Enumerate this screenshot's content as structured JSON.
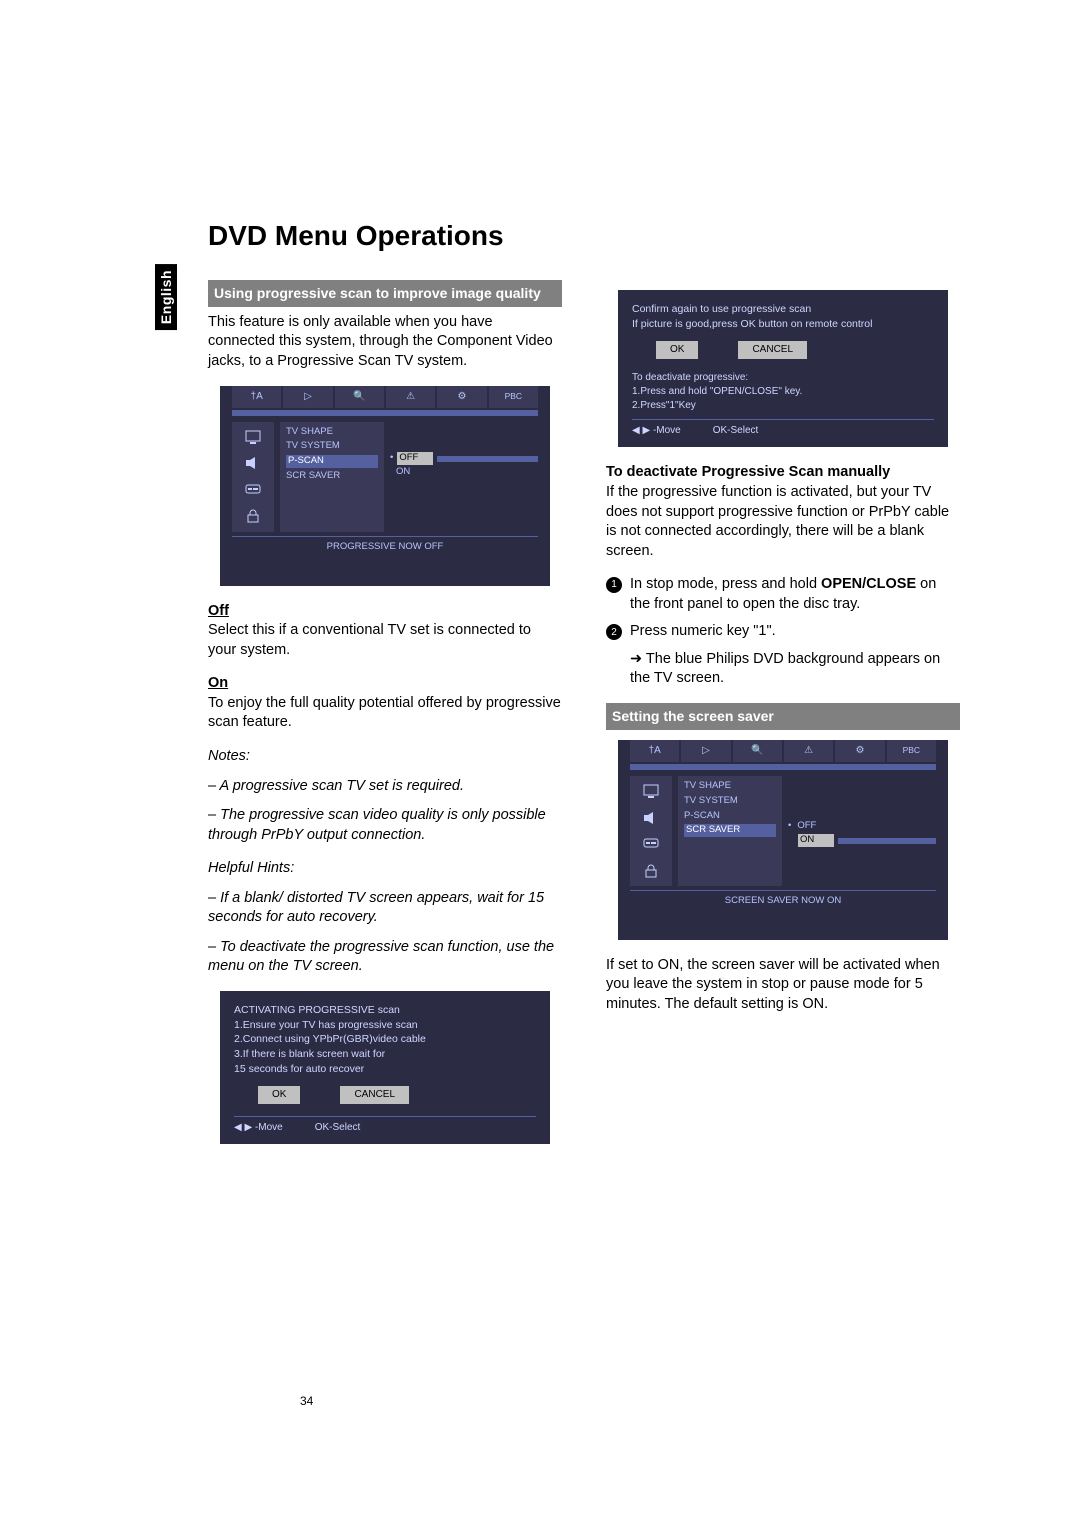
{
  "language_tab": "English",
  "title": "DVD Menu Operations",
  "page_number": "34",
  "section_progscan": {
    "band": "Using progressive scan to improve image quality",
    "intro": "This feature is only available when you have connected this system,  through the Component Video jacks, to a Progressive Scan TV system."
  },
  "osd_pscan": {
    "tabs": [
      "†A",
      "▷",
      "🔍",
      "⚠",
      "⚙",
      "PBC"
    ],
    "items": [
      "TV SHAPE",
      "TV SYSTEM",
      "P-SCAN",
      "SCR SAVER"
    ],
    "opts": [
      "OFF",
      "ON"
    ],
    "status": "PROGRESSIVE NOW OFF"
  },
  "off_head": "Off",
  "off_body": "Select this if a conventional TV set is connected to your system.",
  "on_head": "On",
  "on_body": "To enjoy the full quality potential offered by progressive scan feature.",
  "notes_head": "Notes:",
  "notes_1": "–  A progressive scan TV set is required.",
  "notes_2": "–  The progressive scan video quality is only possible through PrPbY output connection.",
  "hints_head": "Helpful Hints:",
  "hints_1": "–  If a blank/ distorted TV screen appears, wait for 15 seconds for auto recovery.",
  "hints_2": "–  To deactivate the progressive scan function, use the menu on the TV screen.",
  "osd_activate": {
    "head": "ACTIVATING PROGRESSIVE scan",
    "l1": "1.Ensure your TV has progressive scan",
    "l2": "2.Connect  using YPbPr(GBR)video cable",
    "l3": "3.If there is blank screen wait  for",
    "l4": "15 seconds for auto recover",
    "ok": "OK",
    "cancel": "CANCEL",
    "move": "-Move",
    "select": "OK-Select"
  },
  "osd_confirm": {
    "l1": "Confirm again to use progressive scan",
    "l2": "If picture is good,press OK button on remote control",
    "ok": "OK",
    "cancel": "CANCEL",
    "deact_head": "To deactivate progressive:",
    "deact_1": "1.Press and hold \"OPEN/CLOSE\" key.",
    "deact_2": "2.Press\"1\"Key",
    "move": "-Move",
    "select": "OK-Select"
  },
  "deact_head": "To deactivate Progressive Scan manually",
  "deact_body": "If the progressive function is activated, but your TV does not support progressive function or PrPbY cable is not connected accordingly, there will be a blank screen.",
  "step1_a": "In stop mode, press and hold ",
  "step1_b": "OPEN/CLOSE",
  "step1_c": " on the front panel to open the disc tray.",
  "step2": "Press numeric key \"1\".",
  "step2_sub": "The blue Philips DVD background appears on the TV screen.",
  "scr_band": "Setting the screen saver",
  "osd_scr": {
    "items": [
      "TV SHAPE",
      "TV SYSTEM",
      "P-SCAN",
      "SCR SAVER"
    ],
    "opts": [
      "OFF",
      "ON"
    ],
    "status": "SCREEN SAVER NOW ON"
  },
  "scr_body": "If set to ON, the screen saver will be activated when you leave the system in stop or pause mode for 5 minutes. The default setting is ON."
}
